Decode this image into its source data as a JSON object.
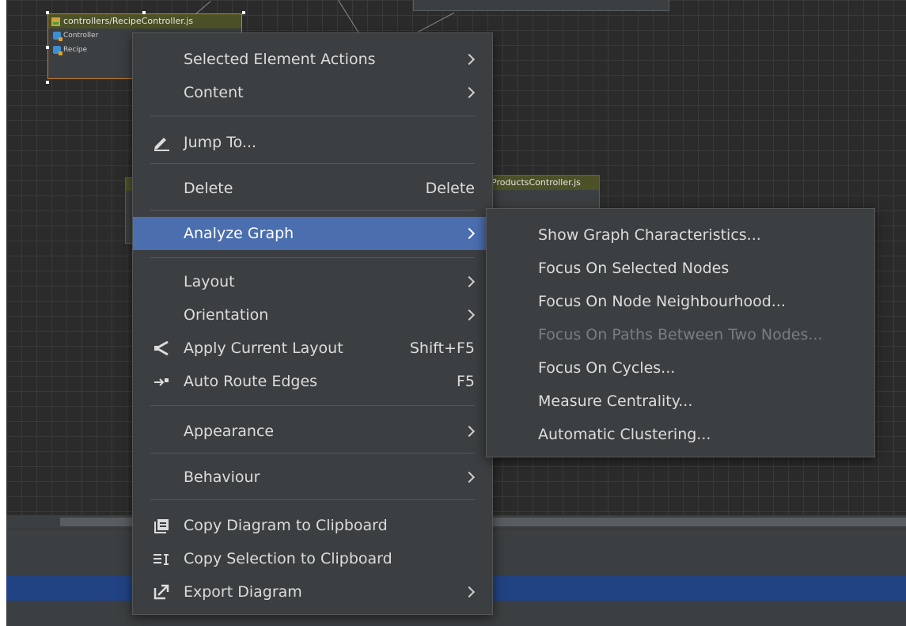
{
  "diagram": {
    "nodes": [
      {
        "title": "controllers/RecipeController.js",
        "rows": [
          "Controller",
          "Recipe"
        ],
        "selected": true
      },
      {
        "title": "ProductsController.js",
        "rows": [],
        "selected": false
      }
    ]
  },
  "context_menu": {
    "items": [
      {
        "label": "Selected Element Actions",
        "submenu": true,
        "icon": ""
      },
      {
        "label": "Content",
        "submenu": true,
        "icon": ""
      },
      {
        "label": "Jump To...",
        "icon": "pencil-icon"
      },
      {
        "label": "Delete",
        "shortcut": "Delete",
        "icon": ""
      },
      {
        "label": "Analyze Graph",
        "submenu": true,
        "highlighted": true,
        "icon": ""
      },
      {
        "label": "Layout",
        "submenu": true,
        "icon": ""
      },
      {
        "label": "Orientation",
        "submenu": true,
        "icon": ""
      },
      {
        "label": "Apply Current Layout",
        "shortcut": "Shift+F5",
        "icon": "layout-tree-icon"
      },
      {
        "label": "Auto Route Edges",
        "shortcut": "F5",
        "icon": "route-edges-icon"
      },
      {
        "label": "Appearance",
        "submenu": true,
        "icon": ""
      },
      {
        "label": "Behaviour",
        "submenu": true,
        "icon": ""
      },
      {
        "label": "Copy Diagram to Clipboard",
        "icon": "copy-icon"
      },
      {
        "label": "Copy Selection to Clipboard",
        "icon": "copy-selection-icon"
      },
      {
        "label": "Export Diagram",
        "submenu": true,
        "icon": "export-icon"
      }
    ]
  },
  "analyze_graph_submenu": {
    "items": [
      {
        "label": "Show Graph Characteristics...",
        "enabled": true
      },
      {
        "label": "Focus On Selected Nodes",
        "enabled": true
      },
      {
        "label": "Focus On Node Neighbourhood...",
        "enabled": true
      },
      {
        "label": "Focus On Paths Between Two Nodes...",
        "enabled": false
      },
      {
        "label": "Focus On Cycles...",
        "enabled": true
      },
      {
        "label": "Measure Centrality...",
        "enabled": true
      },
      {
        "label": "Automatic Clustering...",
        "enabled": true
      }
    ]
  },
  "colors": {
    "menu_background": "#3c3f41",
    "highlight": "#4b6eaf",
    "canvas": "#2b2b2b",
    "status_bar": "#214283",
    "selection_border": "#c9822a"
  }
}
